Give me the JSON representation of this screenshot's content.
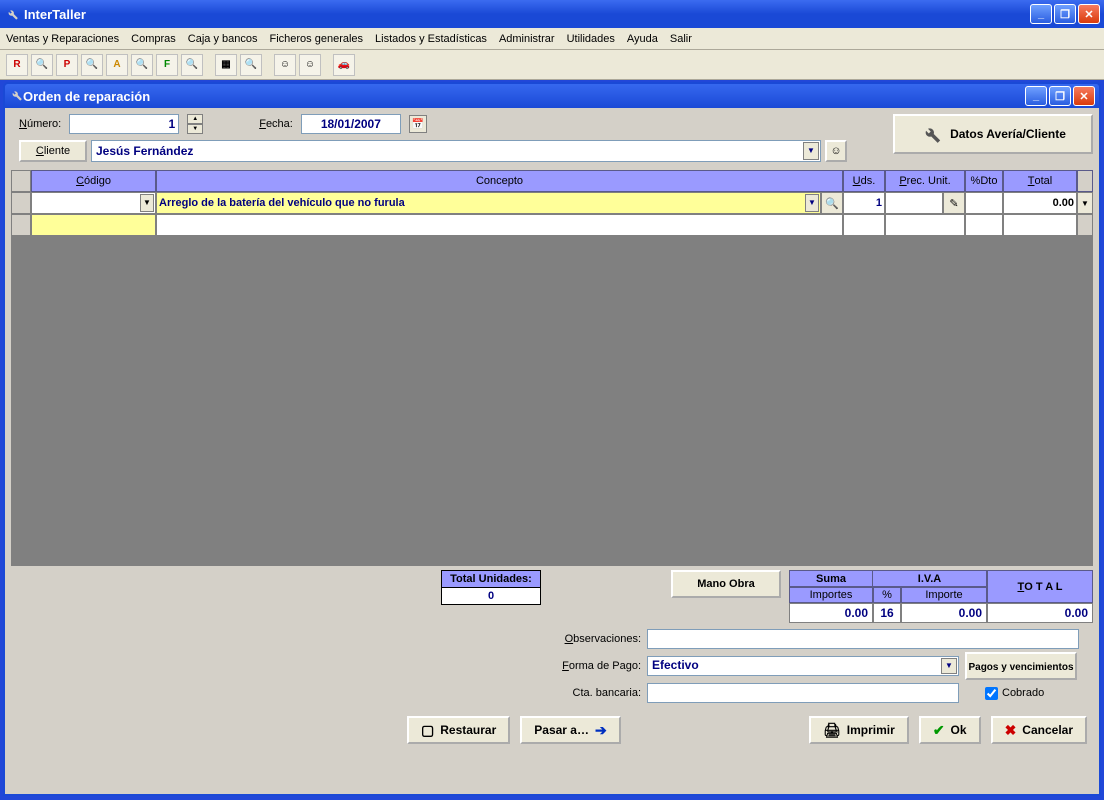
{
  "app_title": "InterTaller",
  "menubar": [
    "Ventas y Reparaciones",
    "Compras",
    "Caja y bancos",
    "Ficheros generales",
    "Listados y Estadísticas",
    "Administrar",
    "Utilidades",
    "Ayuda",
    "Salir"
  ],
  "inner_title": "Orden de reparación",
  "header": {
    "numero_label": "Número:",
    "numero_value": "1",
    "fecha_label": "Fecha:",
    "fecha_value": "18/01/2007",
    "datos_btn": "Datos Avería/Cliente",
    "cliente_btn": "Cliente",
    "cliente_value": "Jesús Fernández"
  },
  "grid": {
    "headers": {
      "codigo": "Código",
      "concepto": "Concepto",
      "uds": "Uds.",
      "punit": "Prec. Unit.",
      "dto": "%Dto",
      "total": "Total"
    },
    "row1": {
      "concepto": "Arreglo de la batería del vehículo que no furula",
      "uds": "1",
      "total": "0.00"
    }
  },
  "totals": {
    "total_unidades_label": "Total Unidades:",
    "total_unidades_value": "0",
    "mano_obra": "Mano Obra",
    "suma_importes_label": "Suma Importes",
    "suma_importes_value": "0.00",
    "iva_label": "I.V.A",
    "iva_pct_label": "%",
    "iva_pct_value": "16",
    "iva_importe_label": "Importe",
    "iva_importe_value": "0.00",
    "total_label": "T O T A L",
    "total_value": "0.00"
  },
  "form": {
    "observaciones_label": "Observaciones:",
    "forma_pago_label": "Forma de Pago:",
    "forma_pago_value": "Efectivo",
    "cta_bancaria_label": "Cta. bancaria:",
    "pagos_btn": "Pagos y vencimientos",
    "cobrado_label": "Cobrado"
  },
  "actions": {
    "restaurar": "Restaurar",
    "pasar": "Pasar a…",
    "imprimir": "Imprimir",
    "ok": "Ok",
    "cancelar": "Cancelar"
  }
}
